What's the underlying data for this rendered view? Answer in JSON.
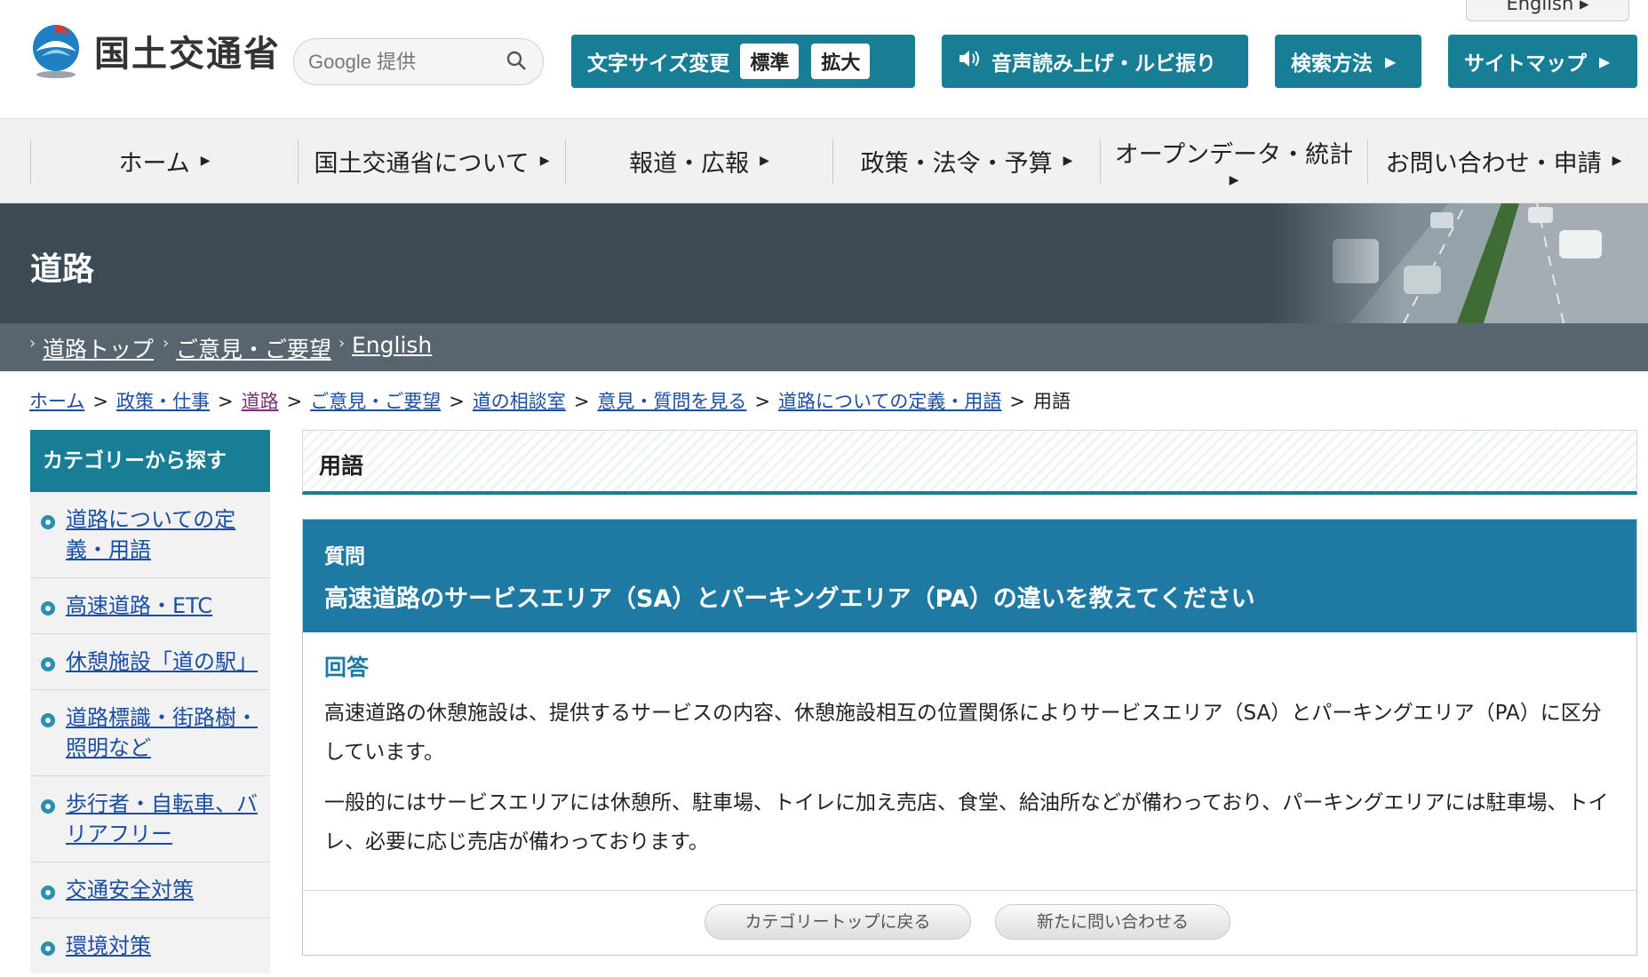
{
  "header": {
    "english_tab": "English ▸",
    "logo_text": "国土交通省",
    "search_placeholder": "Google 提供",
    "font_size": {
      "label": "文字サイズ変更",
      "standard": "標準",
      "large": "拡大"
    },
    "voice_button": "音声読み上げ・ルビ振り",
    "search_method_button": "検索方法",
    "sitemap_button": "サイトマップ",
    "brand_color": "#177e95"
  },
  "gnav": [
    {
      "label": "ホーム"
    },
    {
      "label": "国土交通省について"
    },
    {
      "label": "報道・広報"
    },
    {
      "label": "政策・法令・予算"
    },
    {
      "label": "オープンデータ・統計"
    },
    {
      "label": "お問い合わせ・申請"
    }
  ],
  "banner": {
    "title": "道路"
  },
  "subnav": [
    "道路トップ",
    "ご意見・ご要望",
    "English"
  ],
  "breadcrumb": [
    "ホーム",
    "政策・仕事",
    "道路",
    "ご意見・ご要望",
    "道の相談室",
    "意見・質問を見る",
    "道路についての定義・用語",
    "用語"
  ],
  "sidebar": {
    "heading": "カテゴリーから探す",
    "items": [
      "道路についての定義・用語",
      "高速道路・ETC",
      "休憩施設「道の駅」",
      "道路標識・街路樹・照明など",
      "歩行者・自転車、バリアフリー",
      "交通安全対策",
      "環境対策"
    ]
  },
  "main": {
    "page_title": "用語",
    "question_label": "質問",
    "question_text": "高速道路のサービスエリア（SA）とパーキングエリア（PA）の違いを教えてください",
    "answer_label": "回答",
    "answer_paragraphs": [
      "高速道路の休憩施設は、提供するサービスの内容、休憩施設相互の位置関係によりサービスエリア（SA）とパーキングエリア（PA）に区分しています。",
      "一般的にはサービスエリアには休憩所、駐車場、トイレに加え売店、食堂、給油所などが備わっており、パーキングエリアには駐車場、トイレ、必要に応じ売店が備わっております。"
    ],
    "back_button": "カテゴリートップに戻る",
    "inquiry_button": "新たに問い合わせる"
  }
}
